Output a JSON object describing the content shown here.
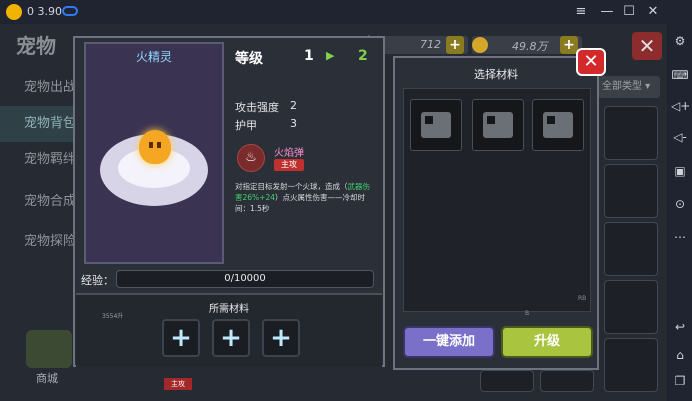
{
  "emulator": {
    "version": "0 3.90",
    "controls": [
      "≡",
      "—",
      "☐",
      "✕"
    ],
    "side_icons": [
      "gear-icon",
      "keyboard-icon",
      "volume-up-icon",
      "volume-down-icon",
      "screenshot-icon",
      "record-icon",
      "more-icon",
      "back-icon",
      "multi-window-icon"
    ]
  },
  "background": {
    "title": "宠物",
    "sidebar_tabs": [
      "宠物出战",
      "宠物背包",
      "宠物羁绊",
      "宠物合成",
      "宠物探险"
    ],
    "gems": "712",
    "coins": "49.8万",
    "filter_label": "全部类型",
    "shop_label": "商城"
  },
  "pet_detail": {
    "name": "火精灵",
    "level_label": "等级",
    "level_from": "1",
    "level_to": "2",
    "stats": [
      {
        "label": "攻击强度",
        "value": "2"
      },
      {
        "label": "护甲",
        "value": "3"
      }
    ],
    "skill": {
      "name": "火焰弹",
      "tag": "主攻",
      "desc_prefix": "对指定目标发射一个火球，造成（",
      "desc_highlight": "武器伤害26%+24",
      "desc_suffix": "）点火属性伤害——冷却时间：1.5秒"
    },
    "exp_label": "经验：",
    "exp_value": "0/10000",
    "required_title": "所需材料",
    "required_small": "3554升",
    "bottom_tag": "主攻"
  },
  "materials": {
    "title": "选择材料",
    "small_label": "RB",
    "bottom_label": "B",
    "auto_add": "一键添加",
    "upgrade": "升级"
  },
  "colors": {
    "upgrade": "#a9c43f",
    "auto_add": "#7a6fc9",
    "close": "#d4292b",
    "level_to": "#7fd04b"
  }
}
